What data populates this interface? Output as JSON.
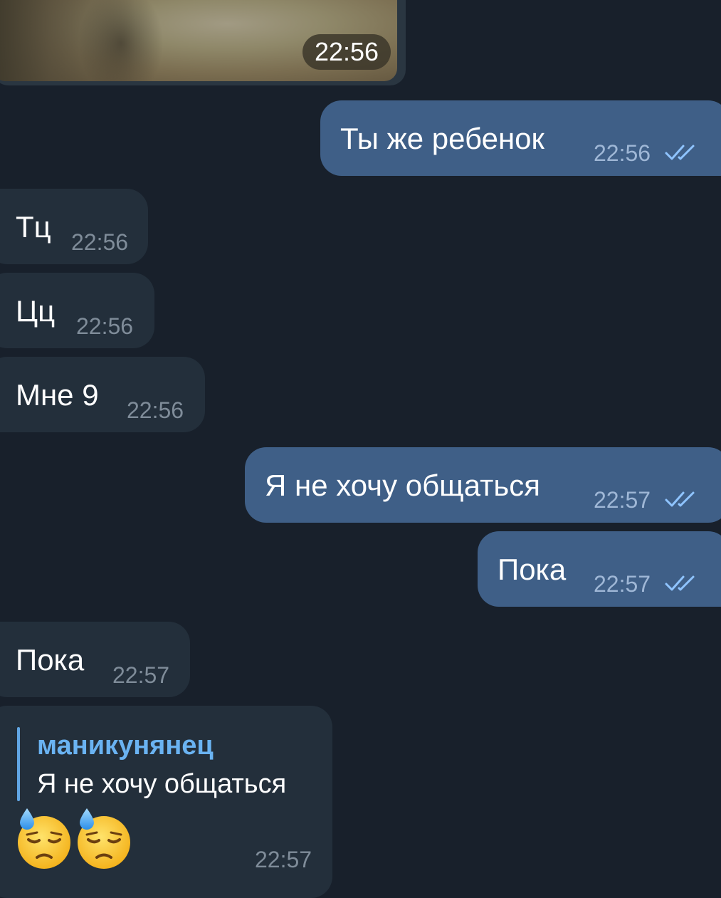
{
  "messages": {
    "photo": {
      "time": "22:56"
    },
    "m1": {
      "text": "Ты же ребенок",
      "time": "22:56",
      "status": "read"
    },
    "m2": {
      "text": "Тц",
      "time": "22:56"
    },
    "m3": {
      "text": "Цц",
      "time": "22:56"
    },
    "m4": {
      "text": "Мне 9",
      "time": "22:56"
    },
    "m5": {
      "text": "Я не хочу общаться",
      "time": "22:57",
      "status": "read"
    },
    "m6": {
      "text": "Пока",
      "time": "22:57",
      "status": "read"
    },
    "m7": {
      "text": "Пока",
      "time": "22:57"
    },
    "m8": {
      "reply_author": "маникунянец",
      "reply_text": "Я не хочу общаться",
      "emoji": [
        "downcast-face-with-sweat",
        "downcast-face-with-sweat"
      ],
      "time": "22:57"
    }
  },
  "colors": {
    "background": "#18202b",
    "incoming_bubble": "#232f3b",
    "outgoing_bubble": "#3f5f87",
    "reply_accent": "#61a6e4",
    "read_ticks": "#8fc4ff"
  }
}
